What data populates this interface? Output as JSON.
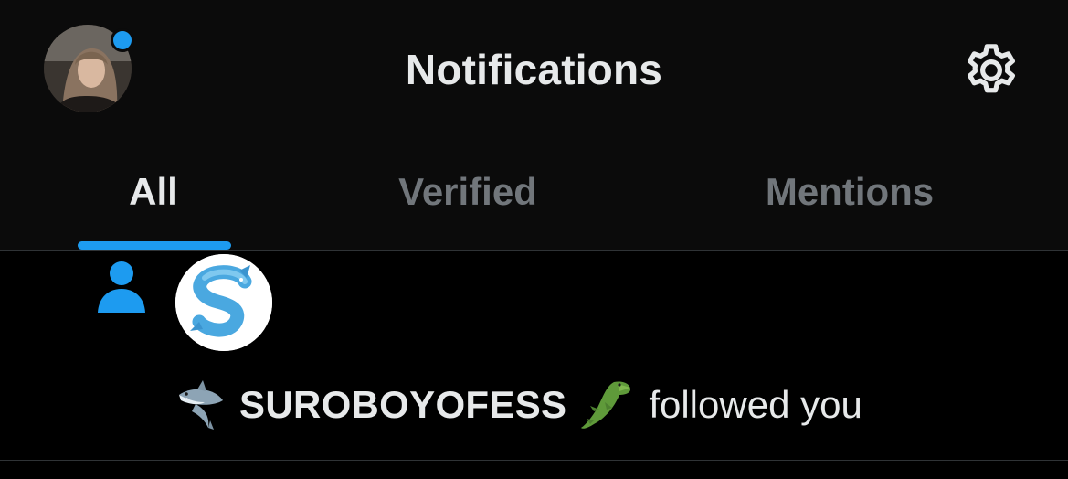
{
  "header": {
    "title": "Notifications",
    "settings_icon": "gear-icon",
    "has_unread_dot": true
  },
  "tabs": [
    {
      "label": "All",
      "active": true
    },
    {
      "label": "Verified",
      "active": false
    },
    {
      "label": "Mentions",
      "active": false
    }
  ],
  "notifications": [
    {
      "type": "follow",
      "type_icon": "person-icon",
      "name_prefix_emoji": "shark-emoji",
      "name": "SUROBOYOFESS",
      "name_suffix_emoji": "crocodile-emoji",
      "action": "followed you"
    }
  ],
  "colors": {
    "accent": "#1d9bf0",
    "background": "#000000",
    "header_background": "#0b0b0b",
    "text_primary": "#e7e9ea",
    "text_secondary": "#71767b",
    "divider": "#2f3336"
  }
}
